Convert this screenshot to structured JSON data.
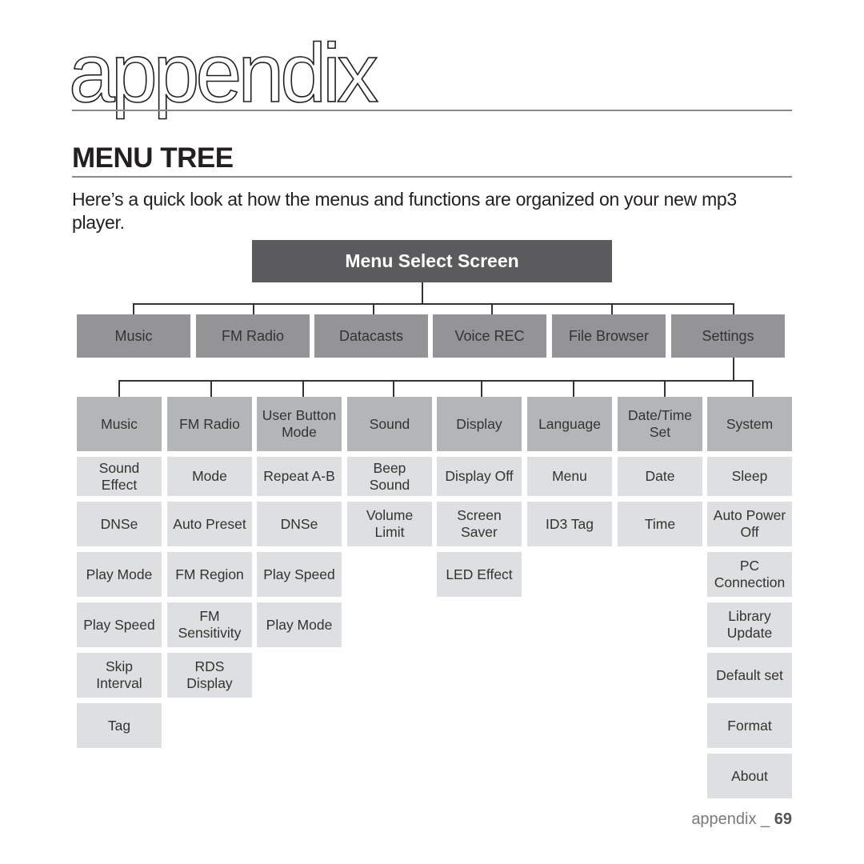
{
  "page": {
    "chapter_title": "appendix",
    "section_title": "MENU TREE",
    "intro": "Here’s a quick look at how the menus and functions are organized on your new mp3 player.",
    "footer_label": "appendix _",
    "page_number": "69"
  },
  "tree": {
    "root": "Menu Select Screen",
    "level1": [
      "Music",
      "FM Radio",
      "Datacasts",
      "Voice REC",
      "File Browser",
      "Settings"
    ],
    "expanded_level1": "Settings",
    "settings_children": [
      {
        "label": "Music",
        "items": [
          "Sound Effect",
          "DNSe",
          "Play Mode",
          "Play Speed",
          "Skip Interval",
          "Tag"
        ]
      },
      {
        "label": "FM Radio",
        "items": [
          "Mode",
          "Auto Preset",
          "FM Region",
          "FM Sensitivity",
          "RDS Display"
        ]
      },
      {
        "label": "User Button Mode",
        "items": [
          "Repeat A-B",
          "DNSe",
          "Play Speed",
          "Play Mode"
        ]
      },
      {
        "label": "Sound",
        "items": [
          "Beep Sound",
          "Volume Limit"
        ]
      },
      {
        "label": "Display",
        "items": [
          "Display Off",
          "Screen Saver",
          "LED Effect"
        ]
      },
      {
        "label": "Language",
        "items": [
          "Menu",
          "ID3 Tag"
        ]
      },
      {
        "label": "Date/Time Set",
        "items": [
          "Date",
          "Time"
        ]
      },
      {
        "label": "System",
        "items": [
          "Sleep",
          "Auto Power Off",
          "PC Connection",
          "Library Update",
          "Default set",
          "Format",
          "About"
        ]
      }
    ]
  }
}
